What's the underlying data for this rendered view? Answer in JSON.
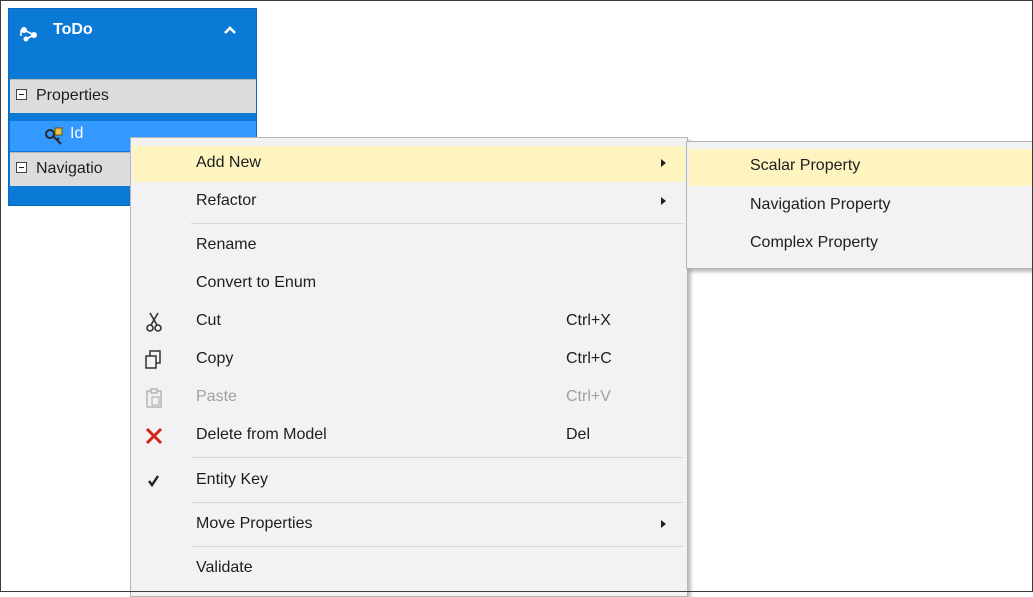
{
  "entity": {
    "title": "ToDo",
    "sections": [
      {
        "label": "Properties"
      },
      {
        "label": "Navigation Properties",
        "visible_text": "Navigatio"
      }
    ],
    "properties": [
      {
        "name": "Id",
        "icon": "key-property-icon"
      }
    ]
  },
  "context_menu": {
    "items": [
      {
        "label": "Add New",
        "submenu": true,
        "highlighted": true
      },
      {
        "label": "Refactor",
        "submenu": true
      },
      {
        "label": "Rename"
      },
      {
        "label": "Convert to Enum"
      },
      {
        "label": "Cut",
        "shortcut": "Ctrl+X",
        "icon": "scissors-icon"
      },
      {
        "label": "Copy",
        "shortcut": "Ctrl+C",
        "icon": "copy-icon"
      },
      {
        "label": "Paste",
        "shortcut": "Ctrl+V",
        "icon": "paste-icon",
        "disabled": true
      },
      {
        "label": "Delete from Model",
        "shortcut": "Del",
        "icon": "delete-icon"
      },
      {
        "label": "Entity Key",
        "icon": "checkmark-icon",
        "checked": true
      },
      {
        "label": "Move Properties",
        "submenu": true
      },
      {
        "label": "Validate"
      }
    ]
  },
  "submenu": {
    "items": [
      {
        "label": "Scalar Property",
        "highlighted": true
      },
      {
        "label": "Navigation Property"
      },
      {
        "label": "Complex Property"
      }
    ]
  },
  "colors": {
    "entity_blue": "#0a7ad6",
    "selection_blue": "#3399ff",
    "menu_background": "#f2f2f2",
    "menu_highlight": "#fdf4bf",
    "delete_red": "#d4231a"
  }
}
